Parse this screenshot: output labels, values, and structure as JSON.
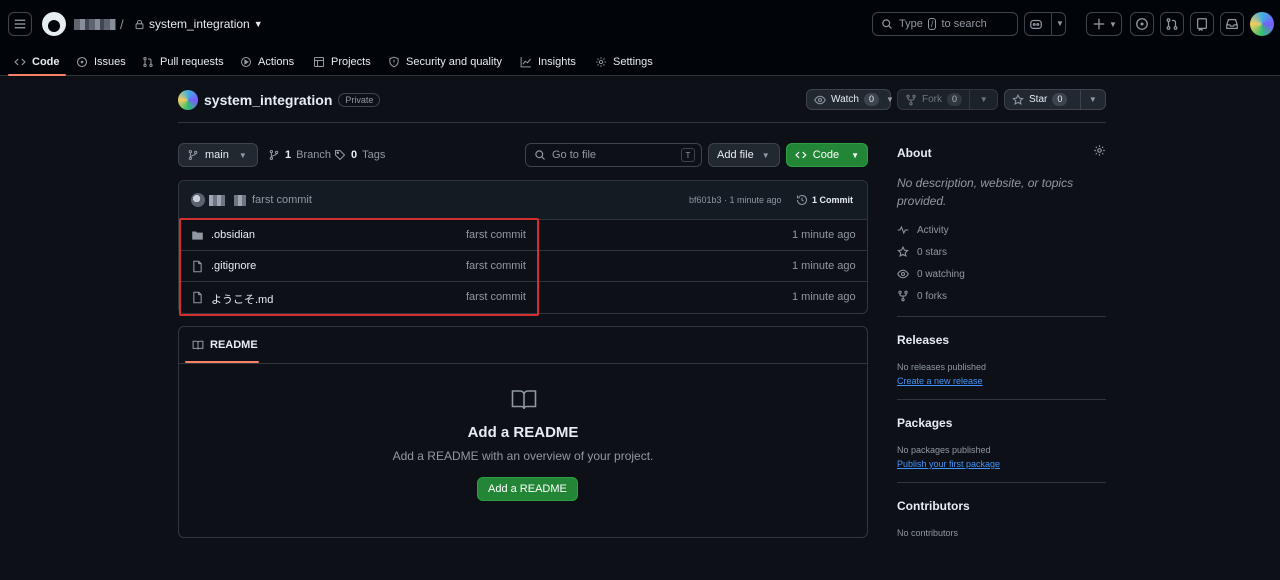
{
  "topbar": {
    "repo_name": "system_integration",
    "search_prefix": "Type",
    "search_key": "/",
    "search_suffix": "to search"
  },
  "tabs": [
    "Code",
    "Issues",
    "Pull requests",
    "Actions",
    "Projects",
    "Security and quality",
    "Insights",
    "Settings"
  ],
  "repo": {
    "title": "system_integration",
    "visibility": "Private",
    "watch_label": "Watch",
    "watch_count": "0",
    "fork_label": "Fork",
    "fork_count": "0",
    "star_label": "Star",
    "star_count": "0"
  },
  "toolbar": {
    "branch": "main",
    "branch_count": "1",
    "branch_label": "Branch",
    "tag_count": "0",
    "tag_label": "Tags",
    "goto_placeholder": "Go to file",
    "goto_key": "T",
    "add_file": "Add file",
    "code": "Code"
  },
  "commit": {
    "message": "farst commit",
    "sha_time": "bf601b3 · 1 minute ago",
    "count": "1 Commit"
  },
  "files": [
    {
      "name": ".obsidian",
      "type": "folder",
      "message": "farst commit",
      "age": "1 minute ago"
    },
    {
      "name": ".gitignore",
      "type": "file",
      "message": "farst commit",
      "age": "1 minute ago"
    },
    {
      "name": "ようこそ.md",
      "type": "file",
      "message": "farst commit",
      "age": "1 minute ago"
    }
  ],
  "readme": {
    "tab": "README",
    "heading": "Add a README",
    "text": "Add a README with an overview of your project.",
    "button": "Add a README"
  },
  "sidebar": {
    "about_title": "About",
    "about_desc": "No description, website, or topics provided.",
    "activity": "Activity",
    "stars": "0 stars",
    "watching": "0 watching",
    "forks": "0 forks",
    "releases_title": "Releases",
    "releases_none": "No releases published",
    "releases_link": "Create a new release",
    "packages_title": "Packages",
    "packages_none": "No packages published",
    "packages_link": "Publish your first package",
    "contributors_title": "Contributors",
    "contributors_none": "No contributors"
  },
  "colors": {
    "accent_green": "#238636",
    "tab_underline": "#f78166",
    "link": "#4493f8",
    "highlight": "#d32f2f"
  }
}
